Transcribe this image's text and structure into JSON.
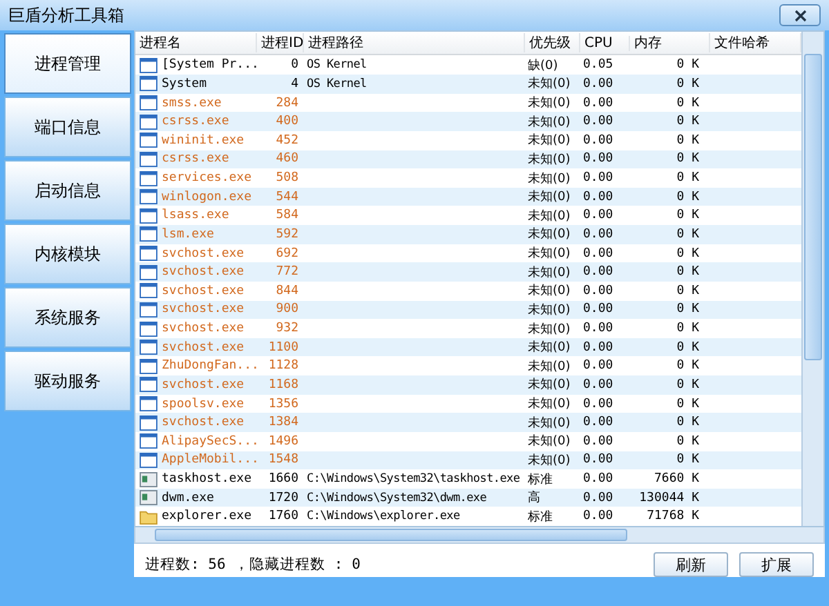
{
  "window": {
    "title": "巨盾分析工具箱"
  },
  "sidebar": {
    "items": [
      {
        "label": "进程管理",
        "selected": true
      },
      {
        "label": "端口信息",
        "selected": false
      },
      {
        "label": "启动信息",
        "selected": false
      },
      {
        "label": "内核模块",
        "selected": false
      },
      {
        "label": "系统服务",
        "selected": false
      },
      {
        "label": "驱动服务",
        "selected": false
      }
    ]
  },
  "table": {
    "columns": [
      "进程名",
      "进程ID",
      "进程路径",
      "优先级",
      "CPU",
      "内存",
      "文件哈希"
    ],
    "rows": [
      {
        "kind": "window",
        "color": "#000000",
        "cells": [
          "[System Pr...",
          "0",
          "OS Kernel",
          "缺(0)",
          "0.05",
          "0 K"
        ]
      },
      {
        "kind": "window",
        "color": "#000000",
        "cells": [
          "System",
          "4",
          "OS Kernel",
          "未知(0)",
          "0.00",
          "0 K"
        ]
      },
      {
        "kind": "window",
        "color": "#d2691e",
        "cells": [
          "smss.exe",
          "284",
          "",
          "未知(0)",
          "0.00",
          "0 K"
        ]
      },
      {
        "kind": "window",
        "color": "#d2691e",
        "cells": [
          "csrss.exe",
          "400",
          "",
          "未知(0)",
          "0.00",
          "0 K"
        ]
      },
      {
        "kind": "window",
        "color": "#d2691e",
        "cells": [
          "wininit.exe",
          "452",
          "",
          "未知(0)",
          "0.00",
          "0 K"
        ]
      },
      {
        "kind": "window",
        "color": "#d2691e",
        "cells": [
          "csrss.exe",
          "460",
          "",
          "未知(0)",
          "0.00",
          "0 K"
        ]
      },
      {
        "kind": "window",
        "color": "#d2691e",
        "cells": [
          "services.exe",
          "508",
          "",
          "未知(0)",
          "0.00",
          "0 K"
        ]
      },
      {
        "kind": "window",
        "color": "#d2691e",
        "cells": [
          "winlogon.exe",
          "544",
          "",
          "未知(0)",
          "0.00",
          "0 K"
        ]
      },
      {
        "kind": "window",
        "color": "#d2691e",
        "cells": [
          "lsass.exe",
          "584",
          "",
          "未知(0)",
          "0.00",
          "0 K"
        ]
      },
      {
        "kind": "window",
        "color": "#d2691e",
        "cells": [
          "lsm.exe",
          "592",
          "",
          "未知(0)",
          "0.00",
          "0 K"
        ]
      },
      {
        "kind": "window",
        "color": "#d2691e",
        "cells": [
          "svchost.exe",
          "692",
          "",
          "未知(0)",
          "0.00",
          "0 K"
        ]
      },
      {
        "kind": "window",
        "color": "#d2691e",
        "cells": [
          "svchost.exe",
          "772",
          "",
          "未知(0)",
          "0.00",
          "0 K"
        ]
      },
      {
        "kind": "window",
        "color": "#d2691e",
        "cells": [
          "svchost.exe",
          "844",
          "",
          "未知(0)",
          "0.00",
          "0 K"
        ]
      },
      {
        "kind": "window",
        "color": "#d2691e",
        "cells": [
          "svchost.exe",
          "900",
          "",
          "未知(0)",
          "0.00",
          "0 K"
        ]
      },
      {
        "kind": "window",
        "color": "#d2691e",
        "cells": [
          "svchost.exe",
          "932",
          "",
          "未知(0)",
          "0.00",
          "0 K"
        ]
      },
      {
        "kind": "window",
        "color": "#d2691e",
        "cells": [
          "svchost.exe",
          "1100",
          "",
          "未知(0)",
          "0.00",
          "0 K"
        ]
      },
      {
        "kind": "window",
        "color": "#d2691e",
        "cells": [
          "ZhuDongFan...",
          "1128",
          "",
          "未知(0)",
          "0.00",
          "0 K"
        ]
      },
      {
        "kind": "window",
        "color": "#d2691e",
        "cells": [
          "svchost.exe",
          "1168",
          "",
          "未知(0)",
          "0.00",
          "0 K"
        ]
      },
      {
        "kind": "window",
        "color": "#d2691e",
        "cells": [
          "spoolsv.exe",
          "1356",
          "",
          "未知(0)",
          "0.00",
          "0 K"
        ]
      },
      {
        "kind": "window",
        "color": "#d2691e",
        "cells": [
          "svchost.exe",
          "1384",
          "",
          "未知(0)",
          "0.00",
          "0 K"
        ]
      },
      {
        "kind": "window",
        "color": "#d2691e",
        "cells": [
          "AlipaySecS...",
          "1496",
          "",
          "未知(0)",
          "0.00",
          "0 K"
        ]
      },
      {
        "kind": "window",
        "color": "#d2691e",
        "cells": [
          "AppleMobil...",
          "1548",
          "",
          "未知(0)",
          "0.00",
          "0 K"
        ]
      },
      {
        "kind": "app",
        "color": "#000000",
        "cells": [
          "taskhost.exe",
          "1660",
          "C:\\Windows\\System32\\taskhost.exe",
          "标准",
          "0.00",
          "7660 K"
        ]
      },
      {
        "kind": "app",
        "color": "#000000",
        "cells": [
          "dwm.exe",
          "1720",
          "C:\\Windows\\System32\\dwm.exe",
          "高",
          "0.00",
          "130044 K"
        ]
      },
      {
        "kind": "folder",
        "color": "#000000",
        "cells": [
          "explorer.exe",
          "1760",
          "C:\\Windows\\explorer.exe",
          "标准",
          "0.00",
          "71768 K"
        ]
      }
    ]
  },
  "status": "进程数: 56 ，隐藏进程数 : 0",
  "buttons": [
    "刷新",
    "扩展"
  ]
}
